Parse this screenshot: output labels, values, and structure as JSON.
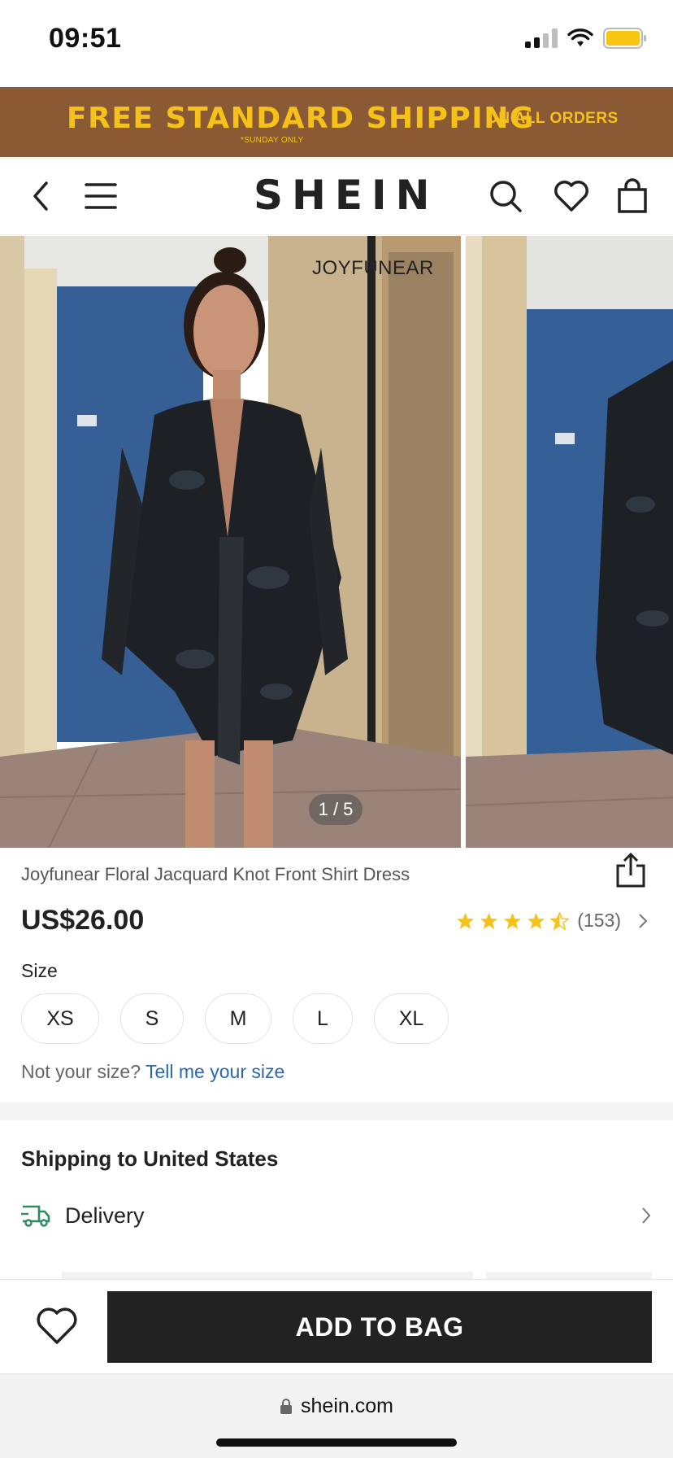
{
  "status_bar": {
    "time": "09:51"
  },
  "promo": {
    "main": "FREE STANDARD SHIPPING",
    "sub": "ON ALL ORDERS",
    "note": "*SUNDAY ONLY"
  },
  "header": {
    "logo": "SHEIN",
    "icons": [
      "back-icon",
      "menu-icon",
      "search-icon",
      "heart-icon",
      "bag-icon"
    ]
  },
  "gallery": {
    "brand_mark": "JOYFUNEAR",
    "counter": "1 / 5"
  },
  "product": {
    "title": "Joyfunear Floral Jacquard Knot Front Shirt Dress",
    "price": "US$26.00",
    "rating_stars": 4.5,
    "rating_count": "(153)"
  },
  "size": {
    "label": "Size",
    "options": [
      "XS",
      "S",
      "M",
      "L",
      "XL"
    ],
    "help_prefix": "Not your size?",
    "help_link": "Tell me your size"
  },
  "shipping": {
    "title": "Shipping to United States",
    "delivery_label": "Delivery"
  },
  "actions": {
    "add_to_bag": "ADD TO BAG"
  },
  "browser": {
    "url": "shein.com"
  },
  "colors": {
    "promo_bg": "#8a5a35",
    "promo_text": "#f6c21a",
    "star": "#f6c21a",
    "link": "#2d68a8",
    "delivery_icon": "#2f8a5f",
    "button_bg": "#222222"
  }
}
